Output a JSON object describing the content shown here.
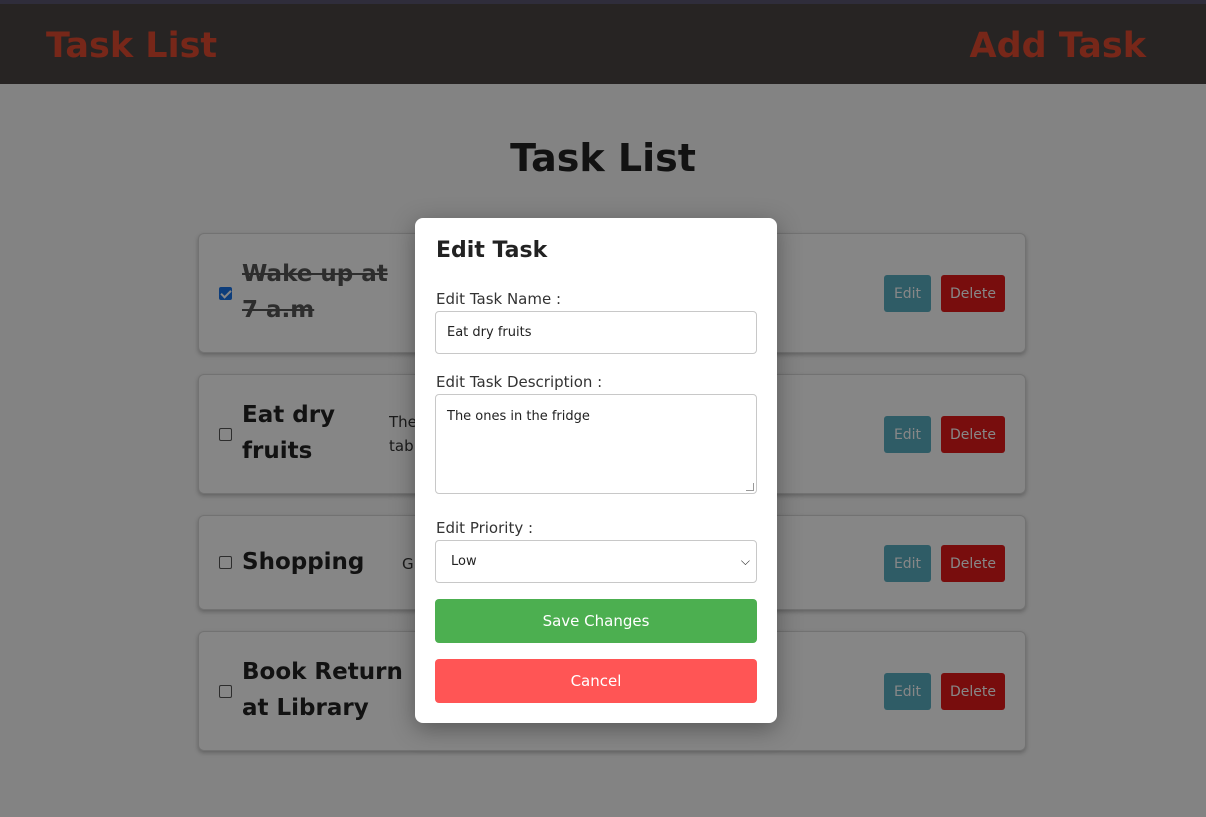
{
  "navbar": {
    "left_link": "Task List",
    "right_link": "Add Task"
  },
  "page": {
    "title": "Task List"
  },
  "tasks": [
    {
      "name": "Wake up at 7 a.m",
      "description": "",
      "done": true,
      "edit_label": "Edit",
      "delete_label": "Delete"
    },
    {
      "name": "Eat dry fruits",
      "description": "The tabl",
      "done": false,
      "edit_label": "Edit",
      "delete_label": "Delete"
    },
    {
      "name": "Shopping",
      "description": "Gr",
      "done": false,
      "edit_label": "Edit",
      "delete_label": "Delete"
    },
    {
      "name": "Book Return at Library",
      "description": "",
      "done": false,
      "edit_label": "Edit",
      "delete_label": "Delete"
    }
  ],
  "modal": {
    "title": "Edit Task",
    "name_label": "Edit Task Name :",
    "name_value": "Eat dry fruits",
    "description_label": "Edit Task Description :",
    "description_value": "The ones in the fridge",
    "priority_label": "Edit Priority :",
    "priority_value": "Low",
    "save_label": "Save Changes",
    "cancel_label": "Cancel"
  },
  "colors": {
    "navbar_bg": "#4a4542",
    "nav_link": "#e04a30",
    "edit_button": "#5aaec0",
    "delete_button": "#e21a1a",
    "save_button": "#4caf50",
    "cancel_button": "#ff5555"
  },
  "icons": {
    "select_arrow": "chevron-down-icon",
    "checkbox": "checkbox-icon"
  }
}
